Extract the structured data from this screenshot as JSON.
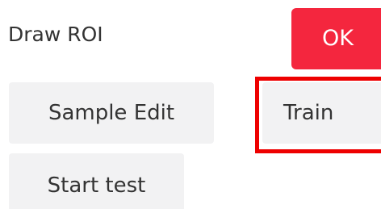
{
  "roi": {
    "label": "Draw ROI"
  },
  "buttons": {
    "ok": "OK",
    "sample_edit": "Sample Edit",
    "train": "Train",
    "start_test": "Start test"
  },
  "colors": {
    "ok_background": "#f4263e",
    "button_background": "#f2f2f3",
    "highlight_border": "#ee0000",
    "text": "#333333"
  }
}
